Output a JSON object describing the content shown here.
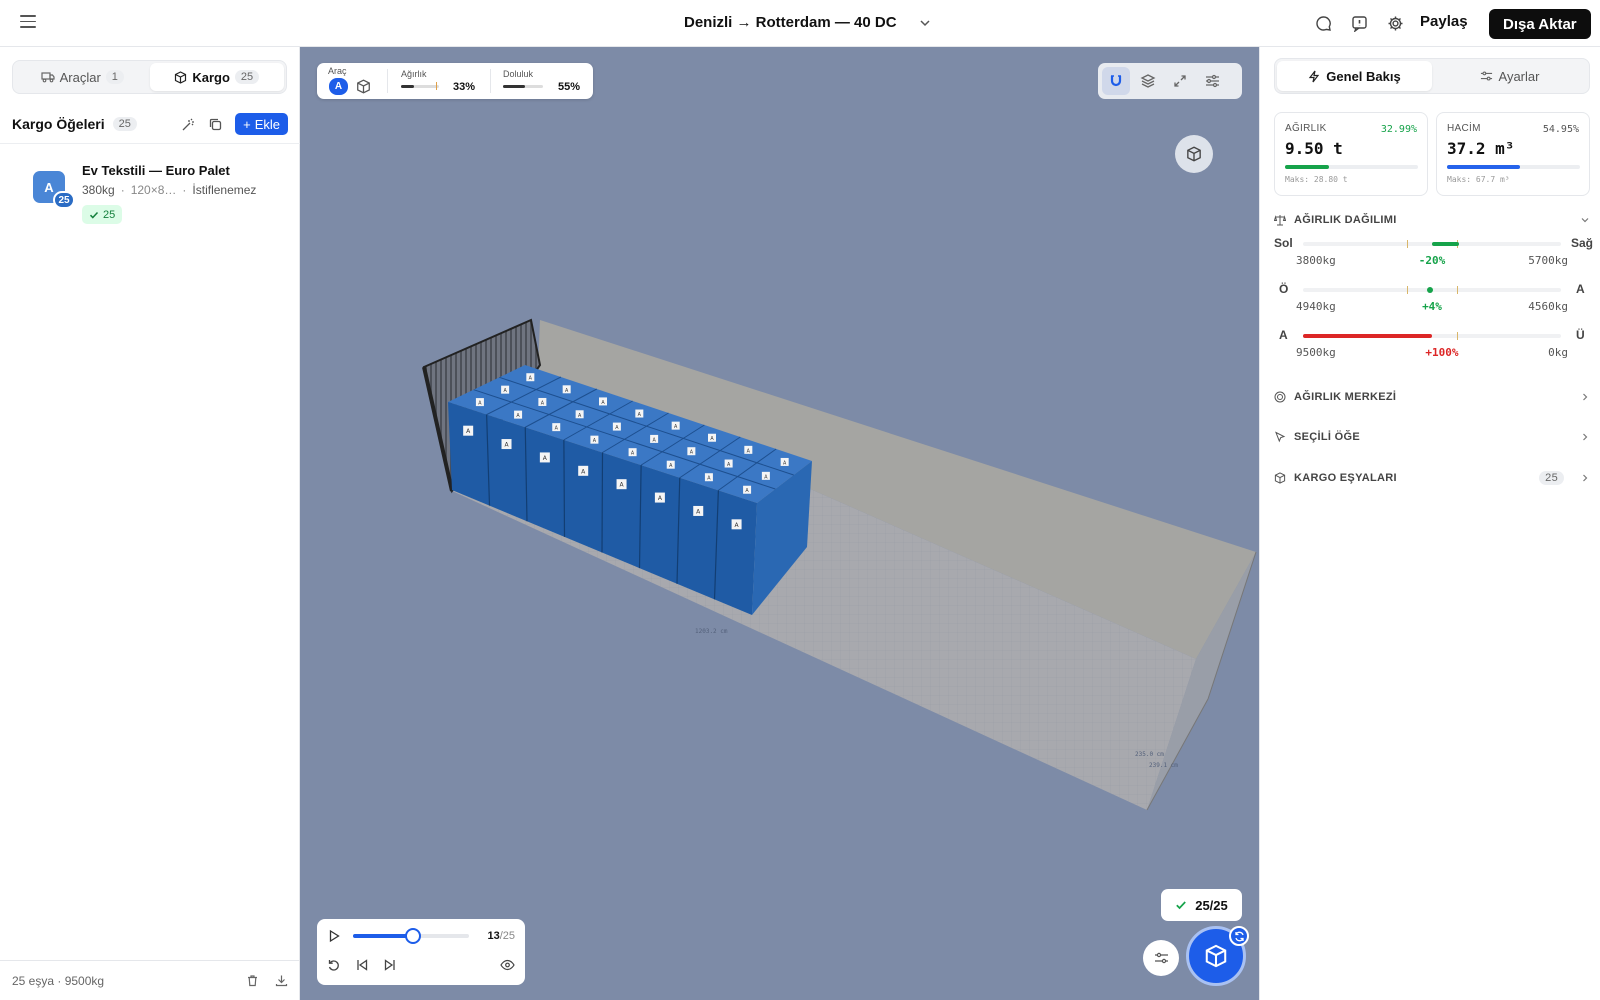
{
  "header": {
    "title": "Denizli → Rotterdam — 40 DC",
    "share_label": "Paylaş",
    "export_label": "Dışa Aktar"
  },
  "left": {
    "tabs": [
      {
        "label": "Araçlar",
        "count": "1",
        "icon": "truck-icon"
      },
      {
        "label": "Kargo",
        "count": "25",
        "icon": "box-icon"
      }
    ],
    "list_title": "Kargo Öğeleri",
    "list_count": "25",
    "add_label": "Ekle",
    "items": [
      {
        "avatar": "A",
        "quantity": "25",
        "name": "Ev Tekstili — Euro Palet",
        "weight": "380kg",
        "dims": "120×8…",
        "stack": "İstiflenemez",
        "placed": "25"
      }
    ],
    "footer": {
      "items": "25 eşya",
      "weight": "9500kg"
    }
  },
  "viewport": {
    "hud": {
      "vehicle_label": "Araç",
      "vehicle_avatar": "A",
      "weight_label": "Ağırlık",
      "weight_value": "33%",
      "weight_fraction": 0.33,
      "fill_label": "Doluluk",
      "fill_value": "55%",
      "fill_fraction": 0.55
    },
    "box_label": "A",
    "dim_labels": [
      "1203.2 cm",
      "235.0 cm",
      "239.1 cm"
    ],
    "placed_status": "25/25",
    "playback": {
      "current": "13",
      "total": "/25",
      "progress": 0.52
    },
    "colors": {
      "accent": "#1d5de9",
      "viewport_bg": "#7d8ba7",
      "box": "#2f6fb8"
    }
  },
  "right": {
    "tabs": [
      {
        "label": "Genel Bakış",
        "icon": "lightning-icon"
      },
      {
        "label": "Ayarlar",
        "icon": "sliders-icon"
      }
    ],
    "weight_card": {
      "label": "AĞIRLIK",
      "pct": "32.99%",
      "value": "9.50 t",
      "max": "Maks: 28.80 t",
      "fraction": 0.3299,
      "color": "#16a34a"
    },
    "volume_card": {
      "label": "HACİM",
      "pct": "54.95%",
      "value": "37.2 m³",
      "max": "Maks: 67.7 m³",
      "fraction": 0.5495,
      "color": "#2563eb"
    },
    "distribution": {
      "title": "AĞIRLIK DAĞILIMI",
      "rows": [
        {
          "left": "Sol",
          "right": "Sağ",
          "left_value": "3800kg",
          "delta": "-20%",
          "right_value": "5700kg",
          "delta_color": "#16a34a"
        },
        {
          "left": "Ö",
          "right": "A",
          "left_value": "4940kg",
          "delta": "+4%",
          "right_value": "4560kg",
          "delta_color": "#16a34a"
        },
        {
          "left": "A",
          "right": "Ü",
          "left_value": "9500kg",
          "delta": "+100%",
          "right_value": "0kg",
          "delta_color": "#dc2626"
        }
      ]
    },
    "sections": {
      "center": "AĞIRLIK MERKEZİ",
      "selected": "SEÇİLİ ÖĞE",
      "cargo": "KARGO EŞYALARI",
      "cargo_count": "25"
    }
  }
}
